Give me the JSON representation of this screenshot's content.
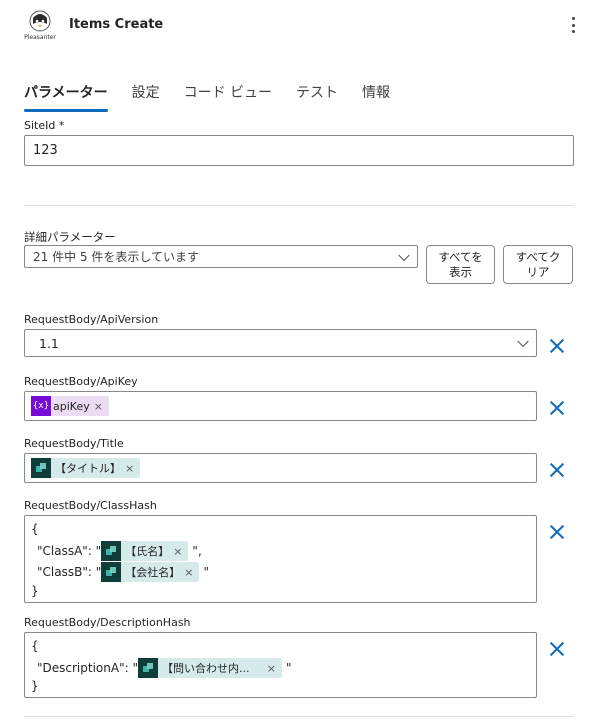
{
  "header": {
    "title": "Items Create",
    "logo_text": "Pleasanter",
    "menu_icon": "more-vertical-icon"
  },
  "tabs": [
    {
      "label": "パラメーター",
      "active": true
    },
    {
      "label": "設定",
      "active": false
    },
    {
      "label": "コード ビュー",
      "active": false
    },
    {
      "label": "テスト",
      "active": false
    },
    {
      "label": "情報",
      "active": false
    }
  ],
  "site_id": {
    "label": "SiteId *",
    "value": "123"
  },
  "advanced": {
    "label": "詳細パラメーター",
    "selected": "21 件中 5 件を表示しています",
    "show_all_button": "すべてを\n表示",
    "clear_all_button": "すべてク\nリア"
  },
  "api_version": {
    "label": "RequestBody/ApiVersion",
    "value": "1.1"
  },
  "api_key": {
    "label": "RequestBody/ApiKey",
    "token_icon": "{x}",
    "token": "apiKey"
  },
  "title_field": {
    "label": "RequestBody/Title",
    "token": "【タイトル】"
  },
  "class_hash": {
    "label": "RequestBody/ClassHash",
    "open": "{",
    "line1_key": "\"ClassA\": \"",
    "line1_token": "【氏名】",
    "line1_end": "\",",
    "line2_key": "\"ClassB\": \"",
    "line2_token": "【会社名】",
    "line2_end": "\"",
    "close": "}"
  },
  "description_hash": {
    "label": "RequestBody/DescriptionHash",
    "open": "{",
    "line1_key": "\"DescriptionA\": \"",
    "line1_token": "【問い合わせ内...",
    "line1_end": "\"",
    "close": "}"
  },
  "colors": {
    "accent": "#0f6cbd",
    "variable_token": "#770bd6",
    "dynamic_token": "#0e3d3a"
  }
}
